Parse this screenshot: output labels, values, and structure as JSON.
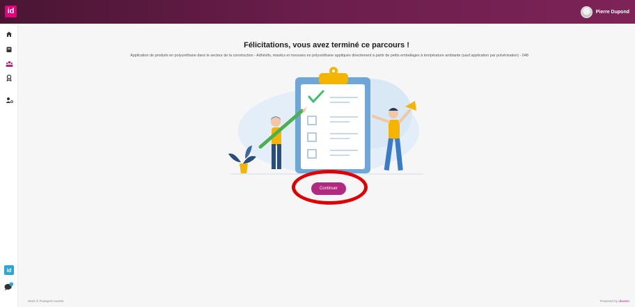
{
  "app": {
    "logo_text": "id",
    "user_name": "Pierre Dupond"
  },
  "sidebar": {
    "items": [
      {
        "icon": "home-icon"
      },
      {
        "icon": "book-icon"
      },
      {
        "icon": "users-icon",
        "active": true
      },
      {
        "icon": "award-icon"
      },
      {
        "icon": "user-settings-icon"
      }
    ],
    "bottom": [
      {
        "icon": "id-logo-icon",
        "text": "id"
      },
      {
        "icon": "chat-icon"
      }
    ]
  },
  "main": {
    "title": "Félicitations, vous avez terminé ce parcours !",
    "subtitle": "Application de produits en polyuréthane dans le secteur de la construction - Adhésifs, mastics et mousses en polyuréthane appliqués directement à partir de petits emballages à température ambiante (sauf application par pulvérisation) - 048",
    "continue_label": "Continuer"
  },
  "footer": {
    "left": "2022 © Passport events",
    "right_prefix": "Powered by",
    "right_brand": "ideasm"
  },
  "colors": {
    "header_start": "#4a1533",
    "header_end": "#7d2358",
    "accent": "#b02a7f",
    "brand_pink": "#e4007c",
    "highlight": "#e00000"
  }
}
